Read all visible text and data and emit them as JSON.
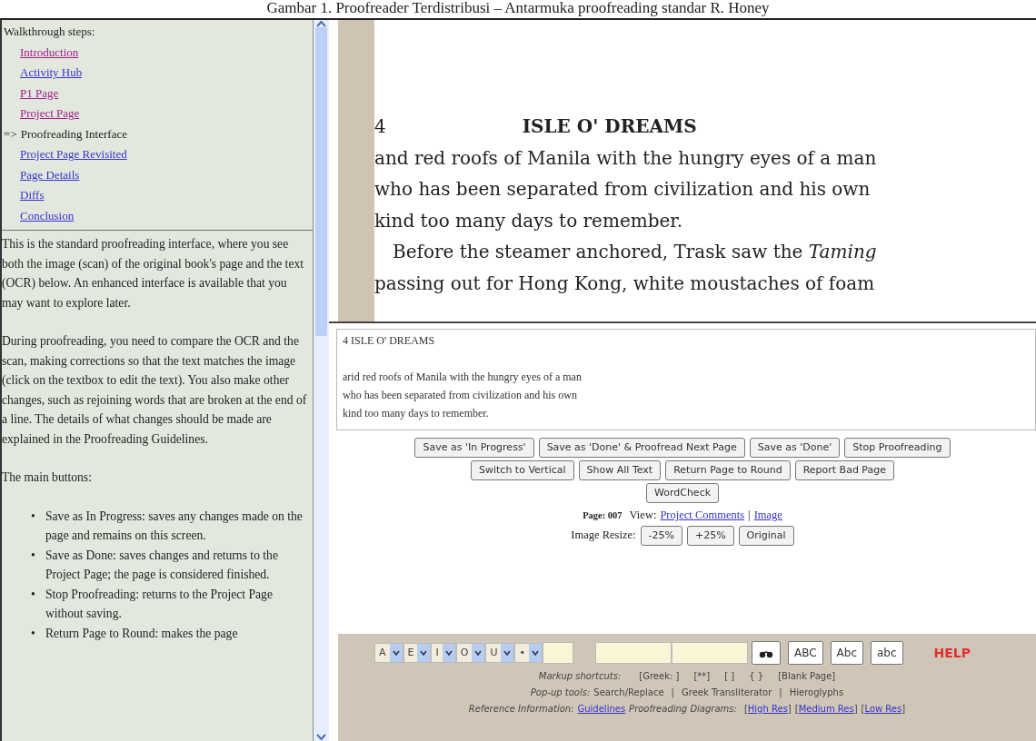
{
  "caption": "Gambar 1. Proofreader Terdistribusi – Antarmuka proofreading standar R. Honey",
  "walkthrough": {
    "title": "Walkthrough steps:",
    "steps": [
      {
        "label": "Introduction",
        "visited": true,
        "current": false
      },
      {
        "label": "Activity Hub",
        "visited": false,
        "current": false
      },
      {
        "label": "P1 Page",
        "visited": true,
        "current": false
      },
      {
        "label": "Project Page",
        "visited": true,
        "current": false
      },
      {
        "label": "Proofreading Interface",
        "current": true,
        "marker": "=>"
      },
      {
        "label": "Project Page Revisited",
        "visited": false,
        "current": false
      },
      {
        "label": "Page Details",
        "visited": false,
        "current": false
      },
      {
        "label": "Diffs",
        "visited": false,
        "current": false
      },
      {
        "label": "Conclusion",
        "visited": false,
        "current": false
      }
    ]
  },
  "help_text": {
    "paragraphs": [
      "This is the standard proofreading interface, where you see both the image (scan) of the original book's page and the text (OCR) below. An enhanced interface is available that you may want to explore later.",
      "During proofreading, you need to compare the OCR and the scan, making corrections so that the text matches the image (click on the textbox to edit the text). You also make other changes, such as rejoining words that are broken at the end of a line. The details of what changes should be made are explained in the Proofreading Guidelines.",
      "The main buttons:"
    ],
    "bullet_marker": "•",
    "bullets": [
      "Save as In Progress: saves any changes made on the page and remains on this screen.",
      "Save as Done: saves changes and returns to the Project Page; the page is considered finished.",
      "Stop Proofreading: returns to the Project Page without saving.",
      "Return Page to Round: makes the page"
    ]
  },
  "scan_page": {
    "page_number": "4",
    "running_head": "ISLE O' DREAMS",
    "lines": [
      {
        "text": "and red roofs of Manila with the hungry eyes of a man",
        "indent": false
      },
      {
        "text": "who has been separated from civilization and his own",
        "indent": false
      },
      {
        "text": "kind too many days to remember.",
        "indent": false
      },
      {
        "text": "Before the steamer anchored, Trask saw the *Taming*",
        "indent": true
      },
      {
        "text": "passing out for Hong Kong, white moustaches of foam",
        "indent": false
      }
    ]
  },
  "ocr_text": "4 ISLE O' DREAMS\n\narid red roofs of Manila with the hungry eyes of a man\nwho has been separated from civilization and his own\nkind too many days to remember.",
  "buttons": [
    [
      "Save as 'In Progress'",
      "Save as 'Done' & Proofread Next Page",
      "Save as 'Done'",
      "Stop Proofreading"
    ],
    [
      "Switch to Vertical",
      "Show All Text",
      "Return Page to Round",
      "Report Bad Page"
    ],
    [
      "WordCheck"
    ]
  ],
  "page_info": {
    "page": "Page: 007",
    "view_label": "View:",
    "links": [
      "Project Comments",
      "Image"
    ],
    "separator": "|"
  },
  "image_resize": {
    "label": "Image Resize:",
    "buttons": [
      "-25%",
      "+25%",
      "Original"
    ]
  },
  "toolbar": {
    "accent_selects": [
      "A",
      "E",
      "I",
      "O",
      "U",
      "•"
    ],
    "case_buttons": [
      "ABC",
      "Abc",
      "abc"
    ],
    "help": "HELP",
    "markup_label": "Markup shortcuts:",
    "markup_items": [
      "[Greek: ]",
      "[**]",
      "[ ]",
      "{ }",
      "[Blank Page]"
    ],
    "popup_label": "Pop-up tools:",
    "popup_items": [
      "Search/Replace",
      "Greek Transliterator",
      "Hieroglyphs"
    ],
    "separator": "|",
    "reference_label": "Reference Information:",
    "guidelines": "Guidelines",
    "diagrams_label": "Proofreading Diagrams:",
    "diagram_links": [
      "High Res",
      "Medium Res",
      "Low Res"
    ],
    "bracket_open": "[",
    "bracket_close": "]"
  }
}
